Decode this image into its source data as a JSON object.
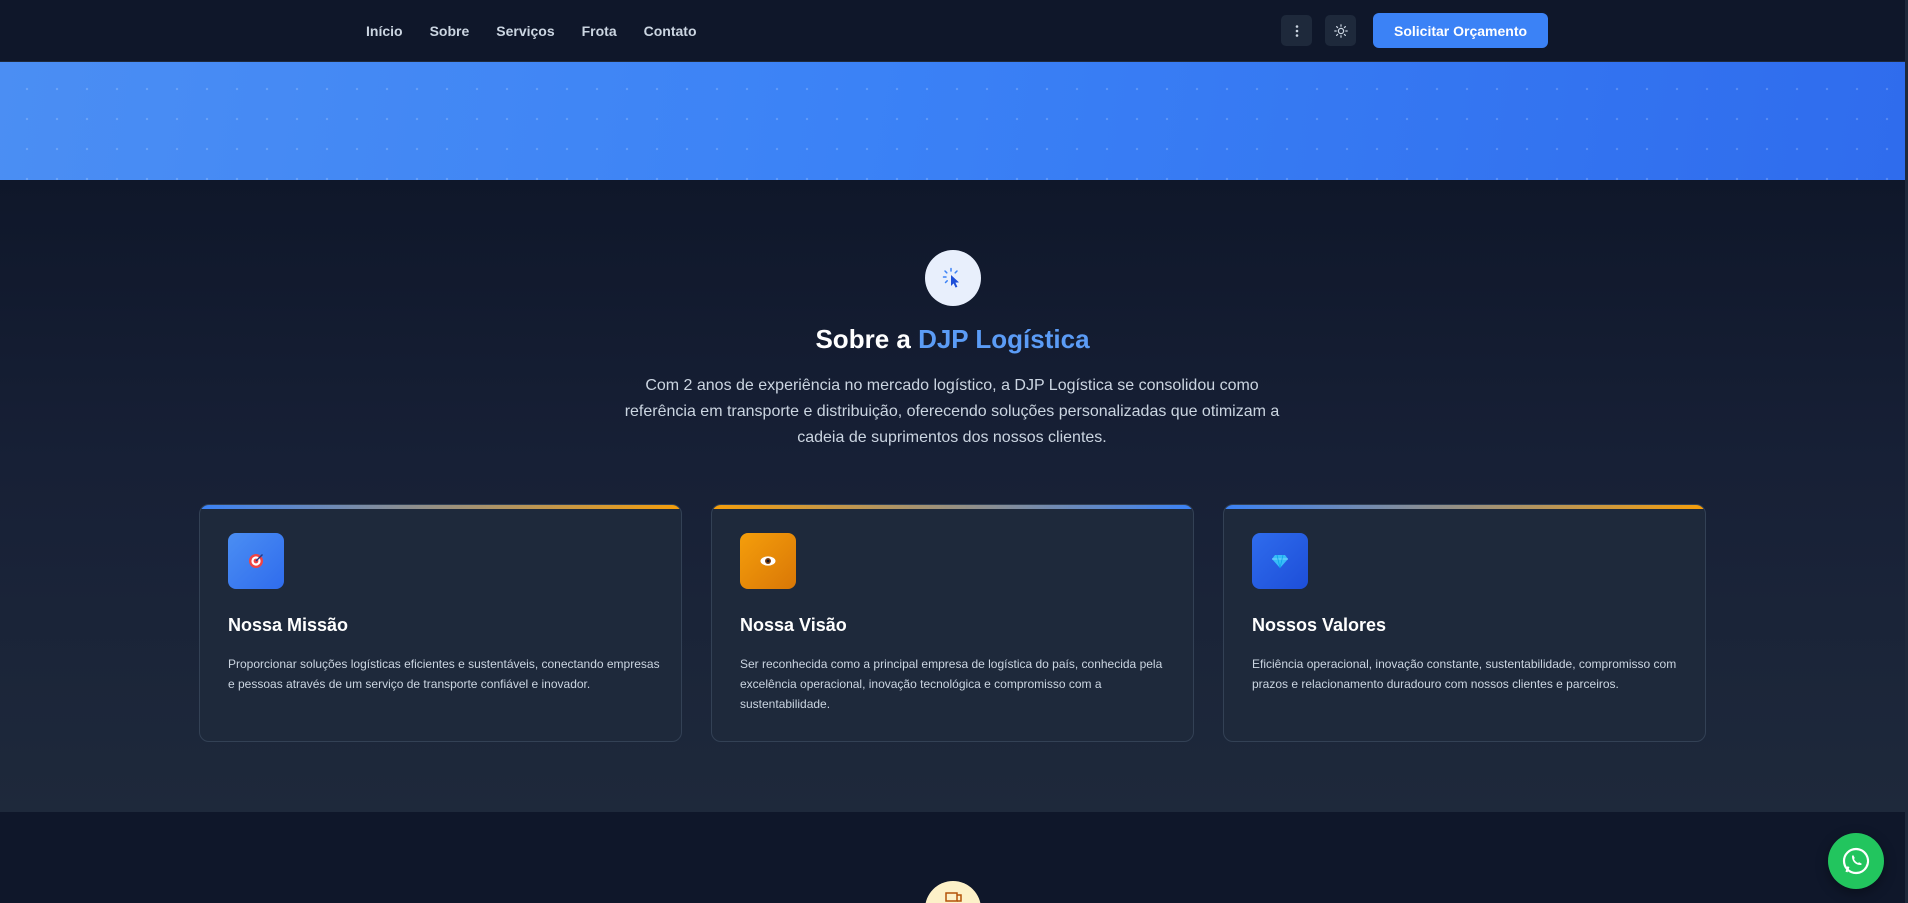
{
  "nav": {
    "items": [
      "Início",
      "Sobre",
      "Serviços",
      "Frota",
      "Contato"
    ]
  },
  "header": {
    "menu_icon": "more-vertical-icon",
    "theme_icon": "sun-icon",
    "cta_label": "Solicitar Orçamento"
  },
  "about": {
    "icon": "pointer-click-icon",
    "title_prefix": "Sobre a ",
    "title_accent": "DJP Logística",
    "description": "Com 2 anos de experiência no mercado logístico, a DJP Logística se consolidou como referência em transporte e distribuição, oferecendo soluções personalizadas que otimizam a cadeia de suprimentos dos nossos clientes.",
    "cards": [
      {
        "icon": "target-icon",
        "title": "Nossa Missão",
        "text": "Proporcionar soluções logísticas eficientes e sustentáveis, conectando empresas e pessoas através de um serviço de transporte confiável e inovador."
      },
      {
        "icon": "eye-icon",
        "title": "Nossa Visão",
        "text": "Ser reconhecida como a principal empresa de logística do país, conhecida pela excelência operacional, inovação tecnológica e compromisso com a sustentabilidade."
      },
      {
        "icon": "gem-icon",
        "title": "Nossos Valores",
        "text": "Eficiência operacional, inovação constante, sustentabilidade, compromisso com prazos e relacionamento duradouro com nossos clientes e parceiros."
      }
    ]
  },
  "floating": {
    "whatsapp_icon": "whatsapp-icon"
  },
  "colors": {
    "background": "#0f172a",
    "primary": "#3b82f6",
    "accent": "#f59e0b",
    "whatsapp": "#22c55e"
  }
}
